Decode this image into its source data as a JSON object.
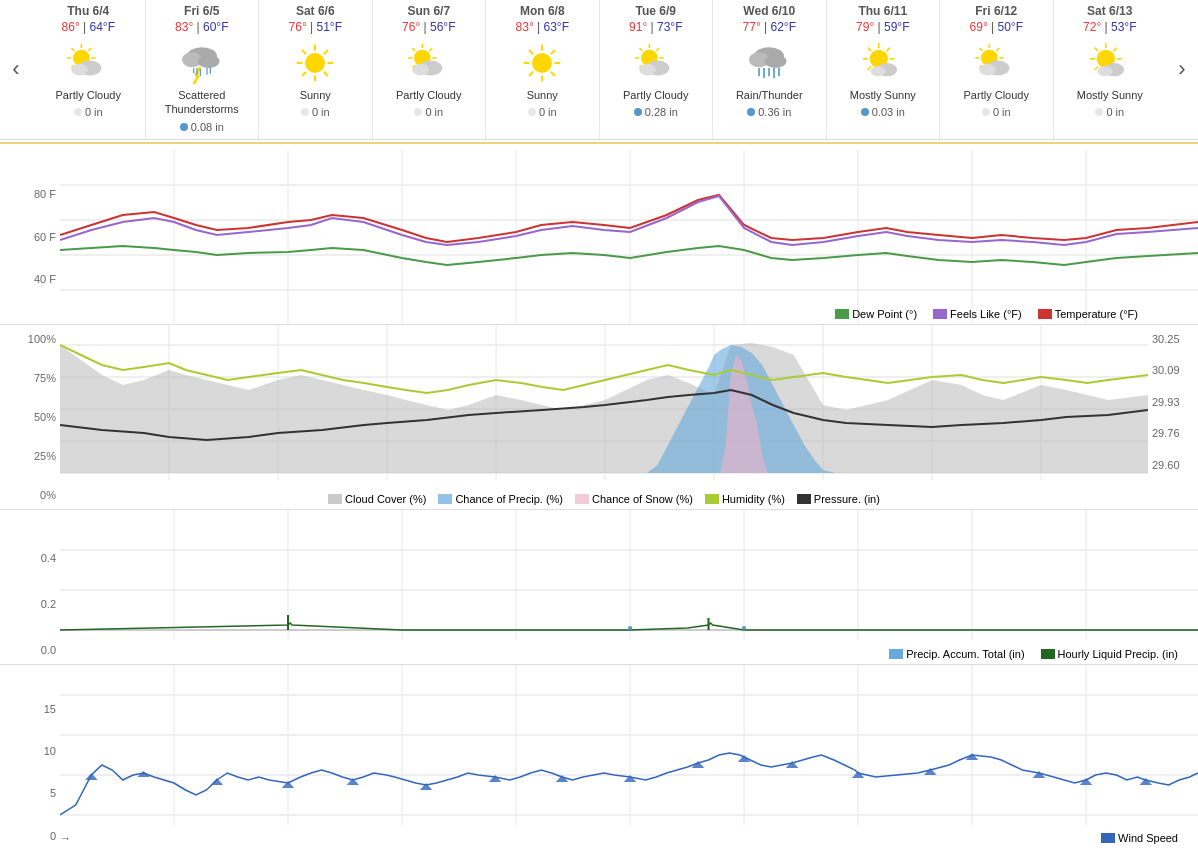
{
  "nav": {
    "prev_label": "‹",
    "next_label": "›"
  },
  "days": [
    {
      "name": "Thu 6/4",
      "high": "86°",
      "low": "64°F",
      "icon": "partly_cloudy",
      "condition": "Partly Cloudy",
      "precip": "0 in",
      "has_rain": false
    },
    {
      "name": "Fri 6/5",
      "high": "83°",
      "low": "60°F",
      "icon": "thunderstorm",
      "condition": "Scattered Thunderstorms",
      "precip": "0.08 in",
      "has_rain": true
    },
    {
      "name": "Sat 6/6",
      "high": "76°",
      "low": "51°F",
      "icon": "sunny",
      "condition": "Sunny",
      "precip": "0 in",
      "has_rain": false
    },
    {
      "name": "Sun 6/7",
      "high": "76°",
      "low": "56°F",
      "icon": "partly_cloudy",
      "condition": "Partly Cloudy",
      "precip": "0 in",
      "has_rain": false
    },
    {
      "name": "Mon 6/8",
      "high": "83°",
      "low": "63°F",
      "icon": "sunny",
      "condition": "Sunny",
      "precip": "0 in",
      "has_rain": false
    },
    {
      "name": "Tue 6/9",
      "high": "91°",
      "low": "73°F",
      "icon": "partly_cloudy",
      "condition": "Partly Cloudy",
      "precip": "0.28 in",
      "has_rain": true
    },
    {
      "name": "Wed 6/10",
      "high": "77°",
      "low": "62°F",
      "icon": "rain_thunder",
      "condition": "Rain/Thunder",
      "precip": "0.36 in",
      "has_rain": true
    },
    {
      "name": "Thu 6/11",
      "high": "79°",
      "low": "59°F",
      "icon": "mostly_sunny",
      "condition": "Mostly Sunny",
      "precip": "0.03 in",
      "has_rain": true
    },
    {
      "name": "Fri 6/12",
      "high": "69°",
      "low": "50°F",
      "icon": "partly_cloudy",
      "condition": "Partly Cloudy",
      "precip": "0 in",
      "has_rain": false
    },
    {
      "name": "Sat 6/13",
      "high": "72°",
      "low": "53°F",
      "icon": "mostly_sunny",
      "condition": "Mostly Sunny",
      "precip": "0 in",
      "has_rain": false
    }
  ],
  "chart1": {
    "legend": [
      {
        "label": "Dew Point (°)",
        "color": "#4a9a4a"
      },
      {
        "label": "Feels Like (°F)",
        "color": "#9966cc"
      },
      {
        "label": "Temperature (°F)",
        "color": "#cc3333"
      }
    ],
    "y_labels": [
      "80 F",
      "60 F",
      "40 F"
    ]
  },
  "chart2": {
    "legend": [
      {
        "label": "Cloud Cover (%)",
        "color": "#aaa"
      },
      {
        "label": "Chance of Precip. (%)",
        "color": "#66aadd"
      },
      {
        "label": "Chance of Snow (%)",
        "color": "#ffaacc"
      },
      {
        "label": "Humidity (%)",
        "color": "#aacc33"
      },
      {
        "label": "Pressure. (in)",
        "color": "#333"
      }
    ],
    "y_labels_left": [
      "100%",
      "75%",
      "50%",
      "25%",
      "0%"
    ],
    "y_labels_right": [
      "30.25",
      "30.09",
      "29.93",
      "29.76",
      "29.60"
    ]
  },
  "chart3": {
    "legend": [
      {
        "label": "Precip. Accum. Total (in)",
        "color": "#66aadd"
      },
      {
        "label": "Hourly Liquid Precip. (in)",
        "color": "#226622"
      }
    ],
    "y_labels": [
      "0.4",
      "0.2",
      "0.0"
    ]
  },
  "chart4": {
    "legend": [
      {
        "label": "Wind Speed",
        "color": "#3366bb"
      }
    ],
    "y_labels": [
      "15",
      "10",
      "5",
      "0"
    ]
  }
}
